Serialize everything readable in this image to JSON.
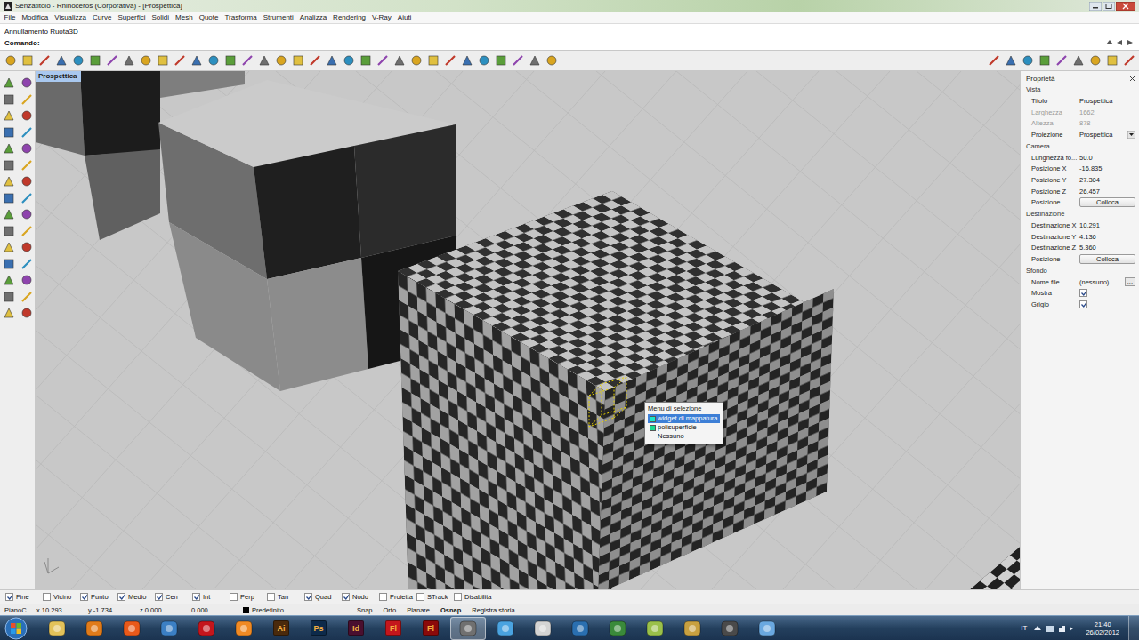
{
  "window": {
    "title": "Senzatitolo - Rhinoceros (Corporativa) - [Prospettica]"
  },
  "menu": [
    "File",
    "Modifica",
    "Visualizza",
    "Curve",
    "Superfici",
    "Solidi",
    "Mesh",
    "Quote",
    "Trasforma",
    "Strumenti",
    "Analizza",
    "Rendering",
    "V-Ray",
    "Aiuti"
  ],
  "command": {
    "history": "Annullamento Ruota3D",
    "prompt": "Comando:"
  },
  "viewport": {
    "title": "Prospettica"
  },
  "selection_menu": {
    "title": "Menu di selezione",
    "items": [
      {
        "label": "widget di mappatura",
        "selected": true,
        "color": "#19e6c8"
      },
      {
        "label": "polisuperficie",
        "selected": false,
        "color": "#19d98f"
      },
      {
        "label": "Nessuno",
        "selected": false,
        "color": ""
      }
    ]
  },
  "properties": {
    "title": "Proprietà",
    "sections": [
      {
        "title": "Vista",
        "rows": [
          {
            "label": "Titolo",
            "value": "Prospettica",
            "kind": "text",
            "disabled": false
          },
          {
            "label": "Larghezza",
            "value": "1662",
            "kind": "text",
            "disabled": true
          },
          {
            "label": "Altezza",
            "value": "878",
            "kind": "text",
            "disabled": true
          },
          {
            "label": "Proiezione",
            "value": "Prospettica",
            "kind": "dropdown",
            "disabled": false
          }
        ]
      },
      {
        "title": "Camera",
        "rows": [
          {
            "label": "Lunghezza fo...",
            "value": "50.0",
            "kind": "text",
            "disabled": false
          },
          {
            "label": "Posizione X",
            "value": "-16.835",
            "kind": "text",
            "disabled": false
          },
          {
            "label": "Posizione Y",
            "value": "27.304",
            "kind": "text",
            "disabled": false
          },
          {
            "label": "Posizione Z",
            "value": "26.457",
            "kind": "text",
            "disabled": false
          },
          {
            "label": "Posizione",
            "value": "Colloca",
            "kind": "button",
            "disabled": false
          }
        ]
      },
      {
        "title": "Destinazione",
        "rows": [
          {
            "label": "Destinazione X",
            "value": "10.291",
            "kind": "text",
            "disabled": false
          },
          {
            "label": "Destinazione Y",
            "value": "4.136",
            "kind": "text",
            "disabled": false
          },
          {
            "label": "Destinazione Z",
            "value": "5.360",
            "kind": "text",
            "disabled": false
          },
          {
            "label": "Posizione",
            "value": "Colloca",
            "kind": "button",
            "disabled": false
          }
        ]
      },
      {
        "title": "Sfondo",
        "rows": [
          {
            "label": "Nome file",
            "value": "(nessuno)",
            "kind": "file",
            "button": "...",
            "disabled": false
          },
          {
            "label": "Mostra",
            "value": "",
            "kind": "checkbox",
            "checked": true,
            "disabled": false
          },
          {
            "label": "Grigio",
            "value": "",
            "kind": "checkbox",
            "checked": true,
            "disabled": false
          }
        ]
      }
    ]
  },
  "osnaps": [
    {
      "label": "Fine",
      "checked": true
    },
    {
      "label": "Vicino",
      "checked": false
    },
    {
      "label": "Punto",
      "checked": true
    },
    {
      "label": "Medio",
      "checked": true
    },
    {
      "label": "Cen",
      "checked": true
    },
    {
      "label": "Int",
      "checked": true
    },
    {
      "label": "Perp",
      "checked": false
    },
    {
      "label": "Tan",
      "checked": false
    },
    {
      "label": "Quad",
      "checked": true
    },
    {
      "label": "Nodo",
      "checked": true
    },
    {
      "label": "Proietta",
      "checked": false
    },
    {
      "label": "STrack",
      "checked": false
    },
    {
      "label": "Disabilita",
      "checked": false
    }
  ],
  "status_bar": {
    "plane": "PianoC",
    "x": "x 10.293",
    "y": "y -1.734",
    "z": "z 0.000",
    "extra": "0.000",
    "layer": {
      "name": "Predefinito",
      "color": "#000000"
    },
    "toggles": [
      {
        "label": "Snap",
        "on": false
      },
      {
        "label": "Orto",
        "on": false
      },
      {
        "label": "Planare",
        "on": false
      },
      {
        "label": "Osnap",
        "on": true
      },
      {
        "label": "Registra storia",
        "on": false
      }
    ]
  },
  "taskbar": {
    "apps": [
      {
        "label": "",
        "color": "#e3c25a",
        "active": false
      },
      {
        "label": "",
        "color": "#e07b1a",
        "active": false
      },
      {
        "label": "",
        "color": "#e8591a",
        "active": false
      },
      {
        "label": "",
        "color": "#3b7fc4",
        "active": false
      },
      {
        "label": "",
        "color": "#c4161c",
        "active": false
      },
      {
        "label": "",
        "color": "#f08a24",
        "active": false
      },
      {
        "label": "Ai",
        "color": "#4a2a0c",
        "active": false
      },
      {
        "label": "Ps",
        "color": "#0d2a4a",
        "active": false
      },
      {
        "label": "Id",
        "color": "#4a0f2f",
        "active": false
      },
      {
        "label": "Fl",
        "color": "#c4161c",
        "active": false
      },
      {
        "label": "Fl",
        "color": "#8b0a0a",
        "active": false
      },
      {
        "label": "",
        "color": "#707070",
        "active": true
      },
      {
        "label": "",
        "color": "#4aa3e0",
        "active": false
      },
      {
        "label": "",
        "color": "#d4d4d4",
        "active": false
      },
      {
        "label": "",
        "color": "#2a6fb0",
        "active": false
      },
      {
        "label": "",
        "color": "#3a8a3a",
        "active": false
      },
      {
        "label": "",
        "color": "#9ac04a",
        "active": false
      },
      {
        "label": "",
        "color": "#c8a040",
        "active": false
      },
      {
        "label": "",
        "color": "#4a4a4a",
        "active": false
      },
      {
        "label": "",
        "color": "#6aa8e0",
        "active": false
      }
    ],
    "language": "IT",
    "time": "21:40",
    "date": "26/02/2012"
  }
}
